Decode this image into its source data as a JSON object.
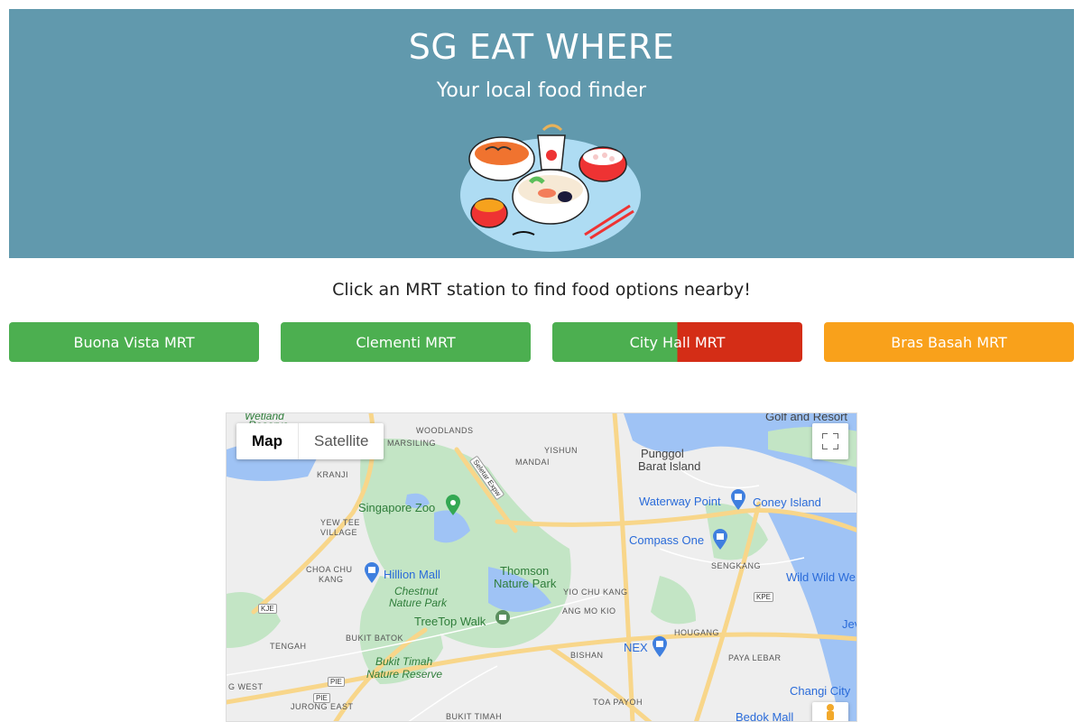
{
  "header": {
    "title": "SG EAT WHERE",
    "subtitle": "Your local food finder"
  },
  "instruction": "Click an MRT station to find food options nearby!",
  "stations": [
    {
      "label": "Buona Vista MRT",
      "colors": [
        "#4caf50"
      ]
    },
    {
      "label": "Clementi MRT",
      "colors": [
        "#4caf50"
      ]
    },
    {
      "label": "City Hall MRT",
      "colors": [
        "#4caf50",
        "#d42d16"
      ]
    },
    {
      "label": "Bras Basah MRT",
      "colors": [
        "#f9a11b"
      ]
    }
  ],
  "map": {
    "type_options": [
      "Map",
      "Satellite"
    ],
    "selected_type": "Map",
    "area_labels": {
      "woodlands": "WOODLANDS",
      "marsiling": "MARSILING",
      "yishun": "YISHUN",
      "mandai": "MANDAI",
      "kranji": "KRANJI",
      "yew_tee": "YEW TEE",
      "village": "VILLAGE",
      "choa_chu_kang": "CHOA CHU",
      "kang": "KANG",
      "yio_chu_kang": "YIO CHU KANG",
      "ang_mo_kio": "ANG MO KIO",
      "sengkang": "SENGKANG",
      "hougang": "HOUGANG",
      "paya_lebar": "PAYA LEBAR",
      "tengah": "TENGAH",
      "bukit_batok": "BUKIT BATOK",
      "bishan": "BISHAN",
      "jurong_east": "JURONG EAST",
      "toa_payoh": "TOA PAYOH",
      "bukit_timah": "BUKIT TIMAH",
      "west": "G WEST",
      "wetland": "Wetland",
      "reserve_top": "Reserve"
    },
    "place_labels": {
      "singapore_zoo": "Singapore Zoo",
      "hillion_mall": "Hillion Mall",
      "chestnut": "Chestnut",
      "nature_park": "Nature Park",
      "thomson": "Thomson",
      "thomson_park": "Nature Park",
      "treetop_walk": "TreeTop Walk",
      "bukit_timah_reserve_1": "Bukit Timah",
      "bukit_timah_reserve_2": "Nature Reserve",
      "punggol": "Punggol",
      "barat_island": "Barat Island",
      "waterway_point": "Waterway Point",
      "coney_island": "Coney Island",
      "compass_one": "Compass One",
      "nex": "NEX",
      "wild_wild_wet": "Wild Wild We",
      "changi_city": "Changi City",
      "bedok_mall": "Bedok Mall",
      "golf_resort": "Golf and Resort",
      "jew": "Jev"
    },
    "highways": {
      "seletar": "Seletar Expw",
      "kje": "KJE",
      "pie": "PIE",
      "pie2": "PIE",
      "kpe": "KPE"
    },
    "colors": {
      "land": "#eeeeee",
      "park": "#c3e5c5",
      "water": "#9fc3f5",
      "road": "#f8d68a",
      "poi": "#3f7fdf",
      "zoo": "#34a853"
    }
  }
}
